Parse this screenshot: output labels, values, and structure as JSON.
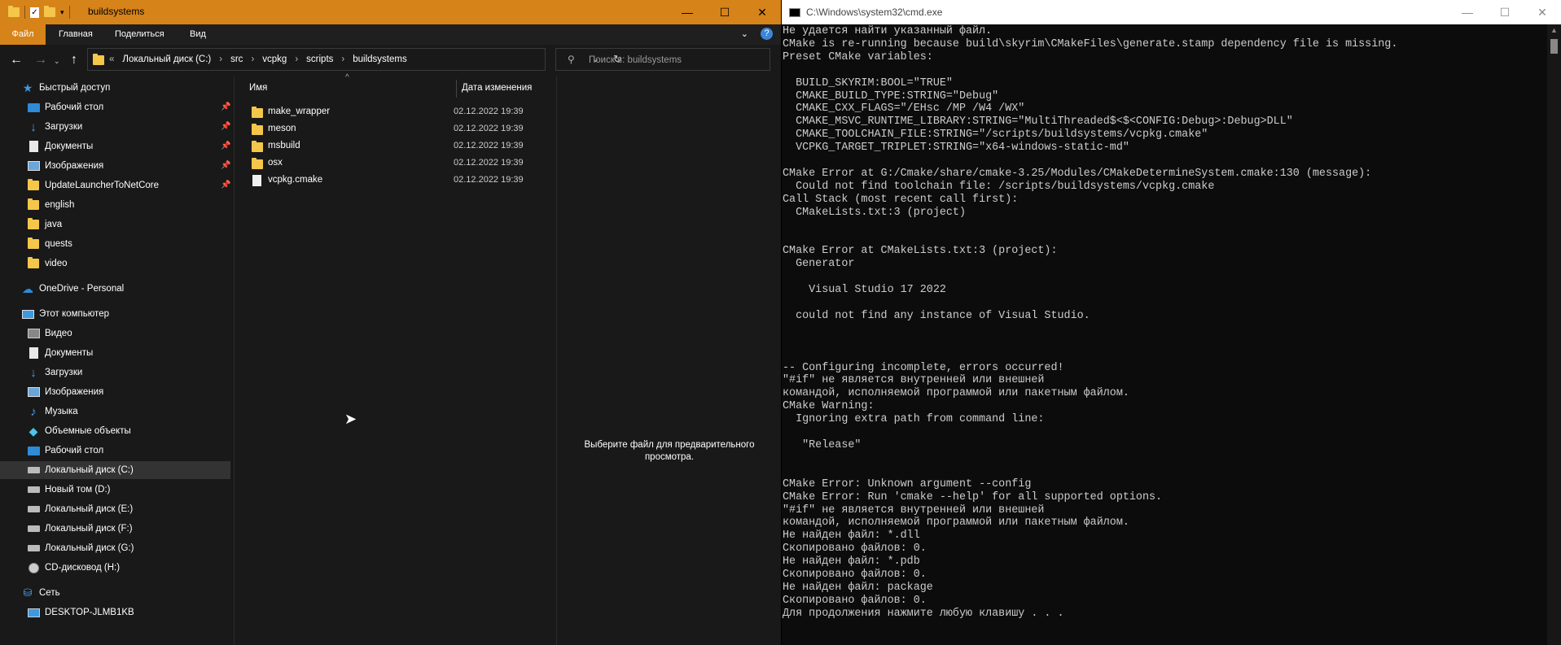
{
  "explorer": {
    "title": "buildsystems",
    "ribbon_tabs": [
      "Файл",
      "Главная",
      "Поделиться",
      "Вид"
    ],
    "breadcrumbs": [
      "Локальный диск (C:)",
      "src",
      "vcpkg",
      "scripts",
      "buildsystems"
    ],
    "search_placeholder": "Поиск в: buildsystems",
    "columns": {
      "name": "Имя",
      "date": "Дата изменения"
    },
    "nav": {
      "quick_access": "Быстрый доступ",
      "quick_items": [
        "Рабочий стол",
        "Загрузки",
        "Документы",
        "Изображения",
        "UpdateLauncherToNetCore",
        "english",
        "java",
        "quests",
        "video"
      ],
      "onedrive": "OneDrive - Personal",
      "this_pc": "Этот компьютер",
      "pc_items": [
        "Видео",
        "Документы",
        "Загрузки",
        "Изображения",
        "Музыка",
        "Объемные объекты",
        "Рабочий стол",
        "Локальный диск (C:)",
        "Новый том (D:)",
        "Локальный диск (E:)",
        "Локальный диск (F:)",
        "Локальный диск (G:)",
        "CD-дисковод (H:)"
      ],
      "network": "Сеть",
      "network_items": [
        "DESKTOP-JLMB1KB"
      ]
    },
    "files": [
      {
        "name": "make_wrapper",
        "date": "02.12.2022 19:39",
        "kind": "folder"
      },
      {
        "name": "meson",
        "date": "02.12.2022 19:39",
        "kind": "folder"
      },
      {
        "name": "msbuild",
        "date": "02.12.2022 19:39",
        "kind": "folder"
      },
      {
        "name": "osx",
        "date": "02.12.2022 19:39",
        "kind": "folder"
      },
      {
        "name": "vcpkg.cmake",
        "date": "02.12.2022 19:39",
        "kind": "file"
      }
    ],
    "preview_message": "Выберите файл для предварительного просмотра."
  },
  "cmd": {
    "title": "C:\\Windows\\system32\\cmd.exe",
    "lines": [
      "Не удается найти указанный файл.",
      "CMake is re-running because build\\skyrim\\CMakeFiles\\generate.stamp dependency file is missing.",
      "Preset CMake variables:",
      "",
      "  BUILD_SKYRIM:BOOL=\"TRUE\"",
      "  CMAKE_BUILD_TYPE:STRING=\"Debug\"",
      "  CMAKE_CXX_FLAGS=\"/EHsc /MP /W4 /WX\"",
      "  CMAKE_MSVC_RUNTIME_LIBRARY:STRING=\"MultiThreaded$<$<CONFIG:Debug>:Debug>DLL\"",
      "  CMAKE_TOOLCHAIN_FILE:STRING=\"/scripts/buildsystems/vcpkg.cmake\"",
      "  VCPKG_TARGET_TRIPLET:STRING=\"x64-windows-static-md\"",
      "",
      "CMake Error at G:/Cmake/share/cmake-3.25/Modules/CMakeDetermineSystem.cmake:130 (message):",
      "  Could not find toolchain file: /scripts/buildsystems/vcpkg.cmake",
      "Call Stack (most recent call first):",
      "  CMakeLists.txt:3 (project)",
      "",
      "",
      "CMake Error at CMakeLists.txt:3 (project):",
      "  Generator",
      "",
      "    Visual Studio 17 2022",
      "",
      "  could not find any instance of Visual Studio.",
      "",
      "",
      "",
      "-- Configuring incomplete, errors occurred!",
      "\"#if\" не является внутренней или внешней",
      "командой, исполняемой программой или пакетным файлом.",
      "CMake Warning:",
      "  Ignoring extra path from command line:",
      "",
      "   \"Release\"",
      "",
      "",
      "CMake Error: Unknown argument --config",
      "CMake Error: Run 'cmake --help' for all supported options.",
      "\"#if\" не является внутренней или внешней",
      "командой, исполняемой программой или пакетным файлом.",
      "Не найден файл: *.dll",
      "Скопировано файлов: 0.",
      "Не найден файл: *.pdb",
      "Скопировано файлов: 0.",
      "Не найден файл: package",
      "Скопировано файлов: 0.",
      "Для продолжения нажмите любую клавишу . . ."
    ]
  }
}
